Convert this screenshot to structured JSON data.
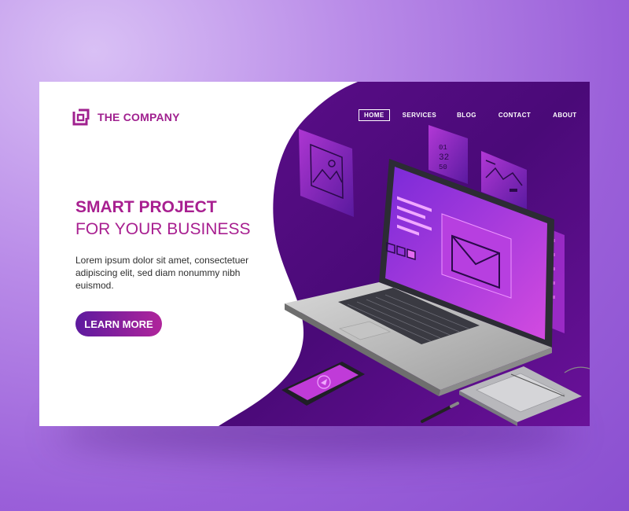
{
  "brand": {
    "name": "THE COMPANY",
    "accent": "#a81f90"
  },
  "nav": {
    "items": [
      {
        "label": "HOME",
        "active": true
      },
      {
        "label": "SERVICES",
        "active": false
      },
      {
        "label": "BLOG",
        "active": false
      },
      {
        "label": "CONTACT",
        "active": false
      },
      {
        "label": "ABOUT",
        "active": false
      }
    ]
  },
  "hero": {
    "title_line1": "SMART PROJECT",
    "title_line2": "FOR YOUR BUSINESS",
    "body": "Lorem ipsum dolor sit amet, consectetuer adipiscing elit, sed diam nonummy nibh euismod.",
    "cta_label": "LEARN MORE"
  },
  "illustration": {
    "calendar_lines": [
      "01",
      "32",
      "50"
    ],
    "icons": [
      "image-icon",
      "chart-icon",
      "envelope-icon",
      "cursor-icon",
      "laptop",
      "tablet",
      "stylus",
      "graphics-tablet"
    ]
  },
  "colors": {
    "purple_dark": "#3a0a62",
    "purple_mid": "#6a1596",
    "magenta": "#c03bd8",
    "cta_start": "#5d1a9e",
    "cta_end": "#b0259b"
  }
}
